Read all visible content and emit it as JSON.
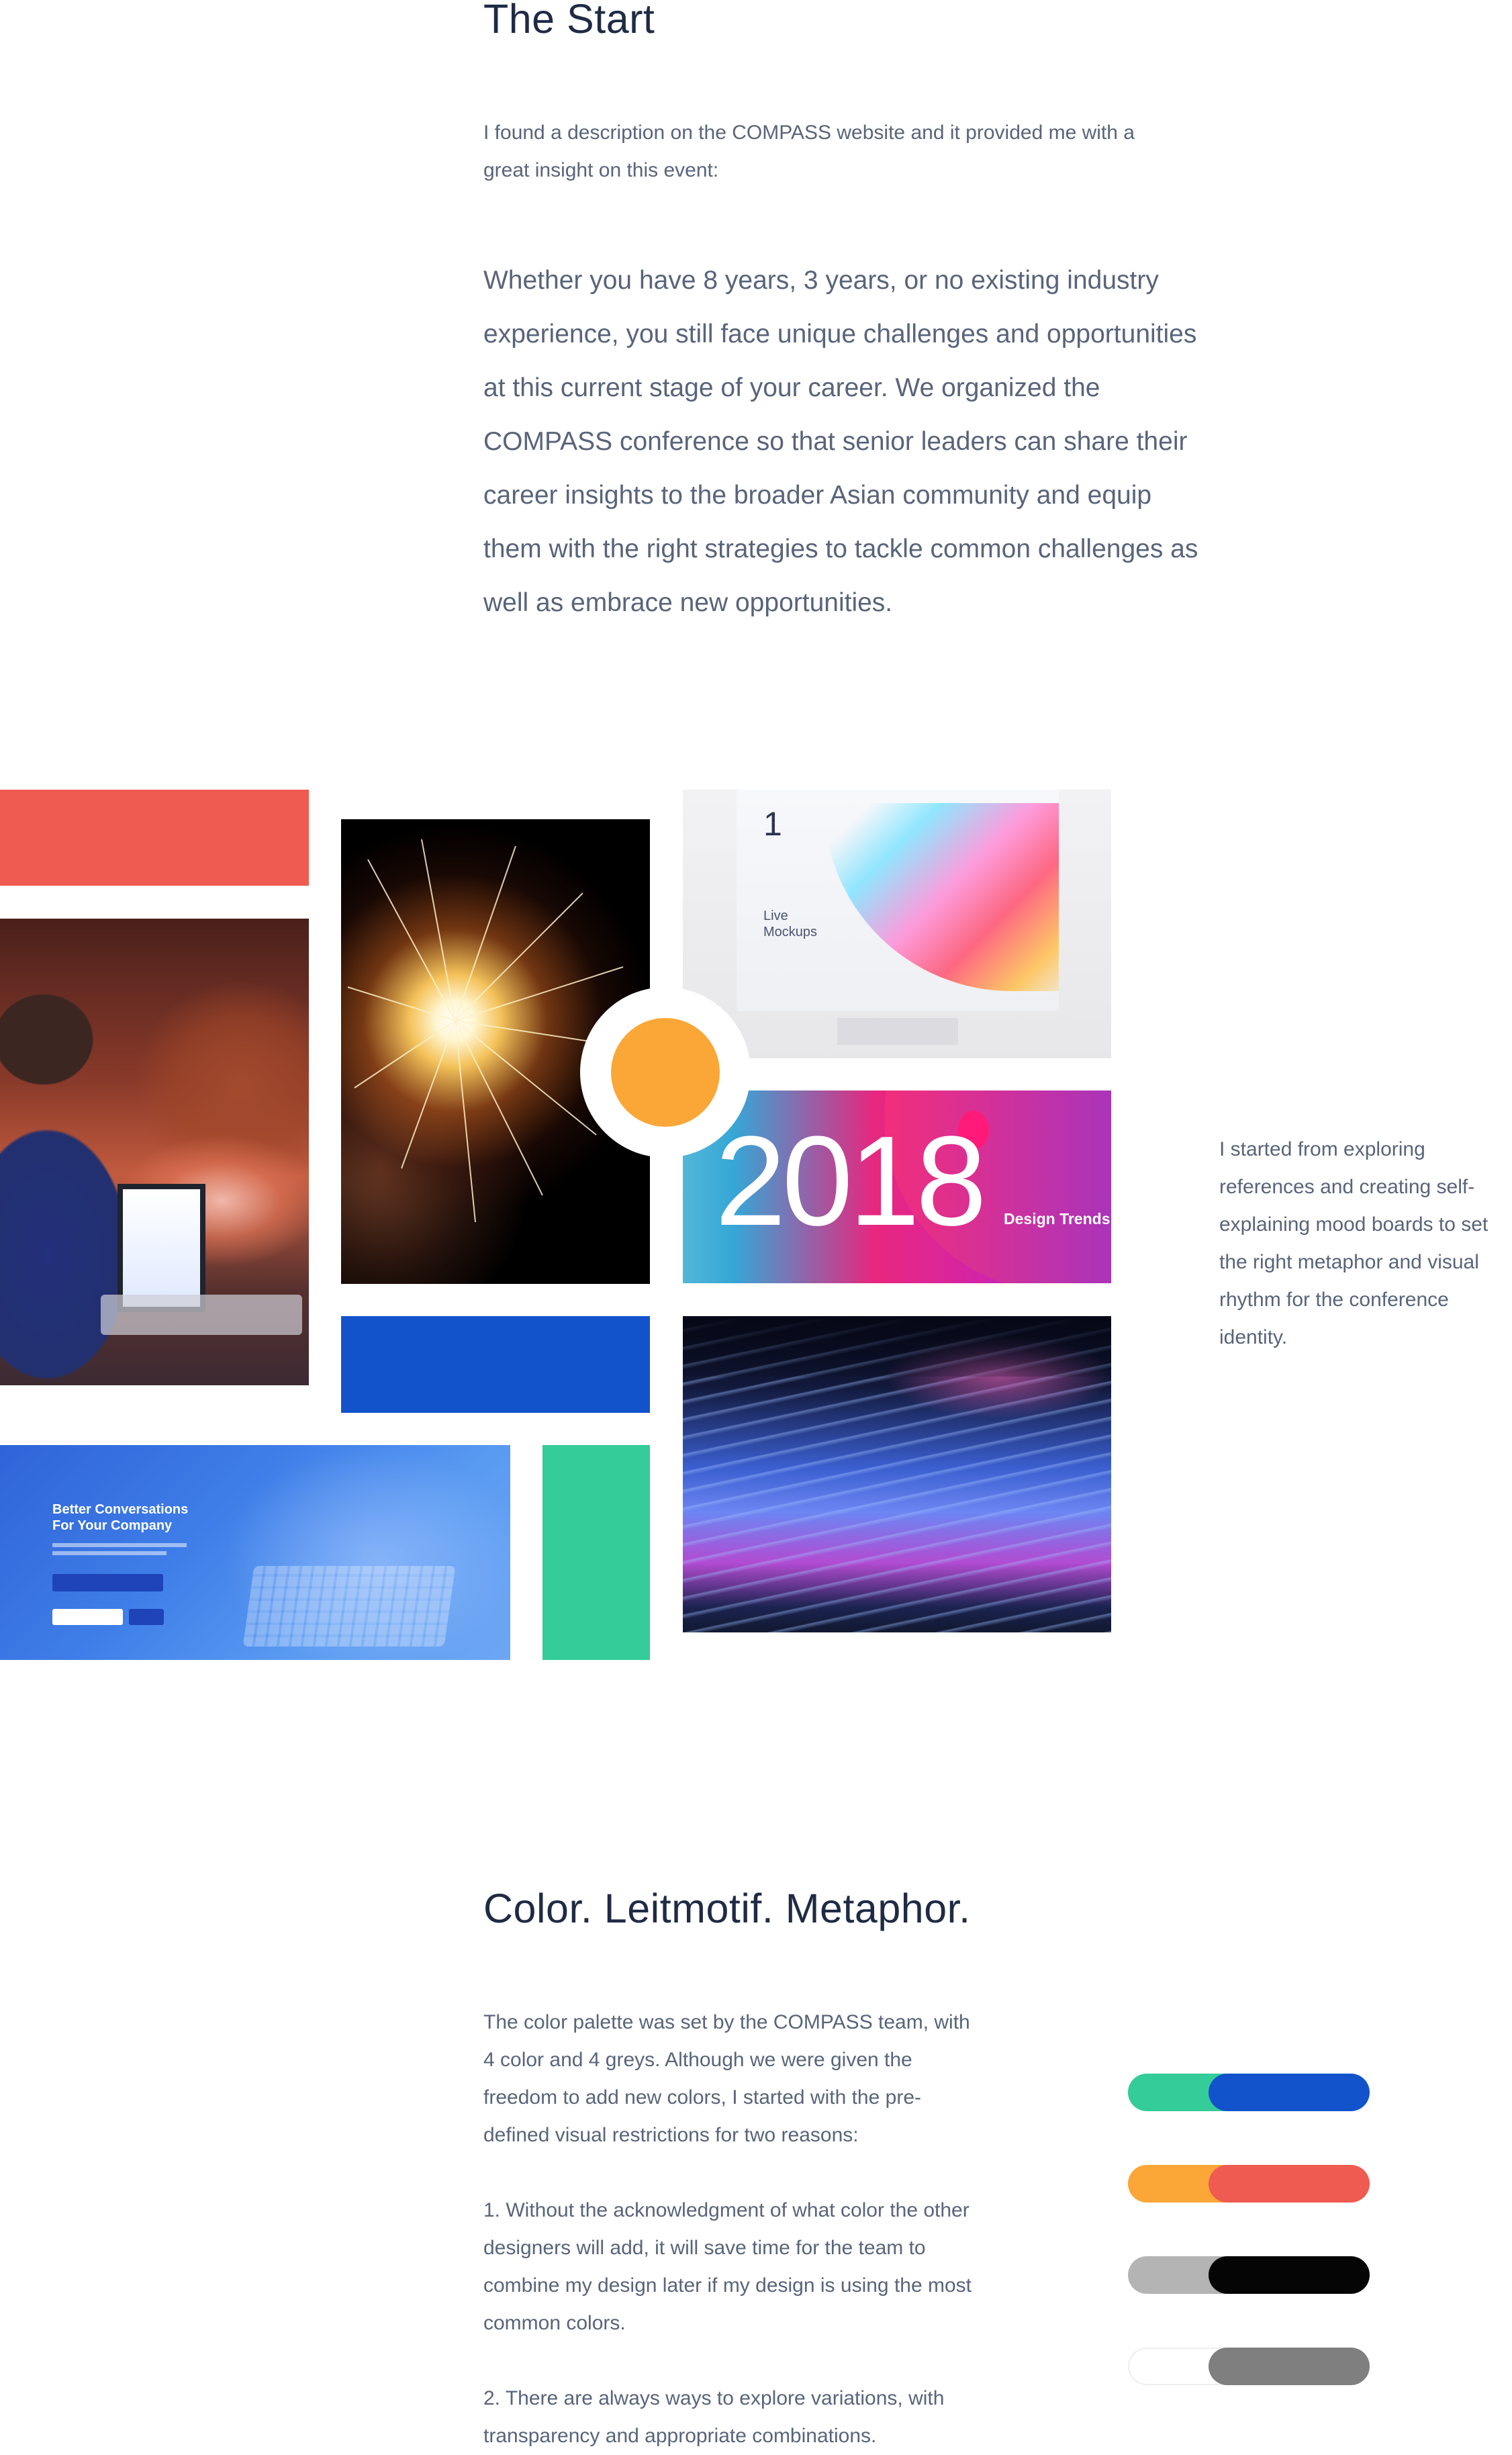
{
  "the_start": {
    "heading": "The Start",
    "intro_line1": "I found a description on the COMPASS website and it provided me with a",
    "intro_line2": "great insight on this event:",
    "quote_lines": [
      "Whether you have 8 years, 3 years, or no existing industry",
      "experience, you still face unique challenges and opportunities",
      "at this current stage of your career. We organized the",
      "COMPASS conference so that senior leaders can share their",
      "career insights to the broader Asian community and equip",
      "them with the right strategies to tackle common challenges as",
      "well as embrace new opportunities."
    ]
  },
  "moodboard": {
    "mockup_number": "1",
    "mockup_caption_line1": "Live",
    "mockup_caption_line2": "Mockups",
    "trends_year": "2018",
    "trends_label": "Design Trends",
    "landing_title_line1": "Better Conversations",
    "landing_title_line2": "For Your Company",
    "side_note_lines": [
      "I started from exploring",
      "references and creating self-",
      "explaining mood boards to set",
      "the right metaphor and visual",
      "rhythm for the conference",
      "identity."
    ],
    "colors": {
      "red": "#ef5a51",
      "blue": "#1253cc",
      "green": "#34cc98",
      "orange": "#fba737"
    }
  },
  "color_section": {
    "heading": "Color. Leitmotif. Metaphor.",
    "paragraph1_lines": [
      "The color palette was set by the COMPASS team, with",
      "4 color and 4 greys. Although we were given the",
      "freedom to add new colors, I started with the pre-",
      "defined visual restrictions for two reasons:"
    ],
    "paragraph2_lines": [
      "1. Without the acknowledgment of what color the other",
      "designers will add, it will save time for the team to",
      "combine my design later if my design is using the most",
      "common colors."
    ],
    "paragraph3_lines": [
      "2. There are always ways to explore variations, with",
      "transparency and appropriate combinations."
    ],
    "palette_pairs": [
      {
        "left": "#34cc98",
        "right": "#1253cc"
      },
      {
        "left": "#fba737",
        "right": "#ef5a51"
      },
      {
        "left": "#b4b4b4",
        "right": "#050505"
      },
      {
        "left": "#ffffff",
        "right": "#7f7f7f"
      }
    ]
  }
}
